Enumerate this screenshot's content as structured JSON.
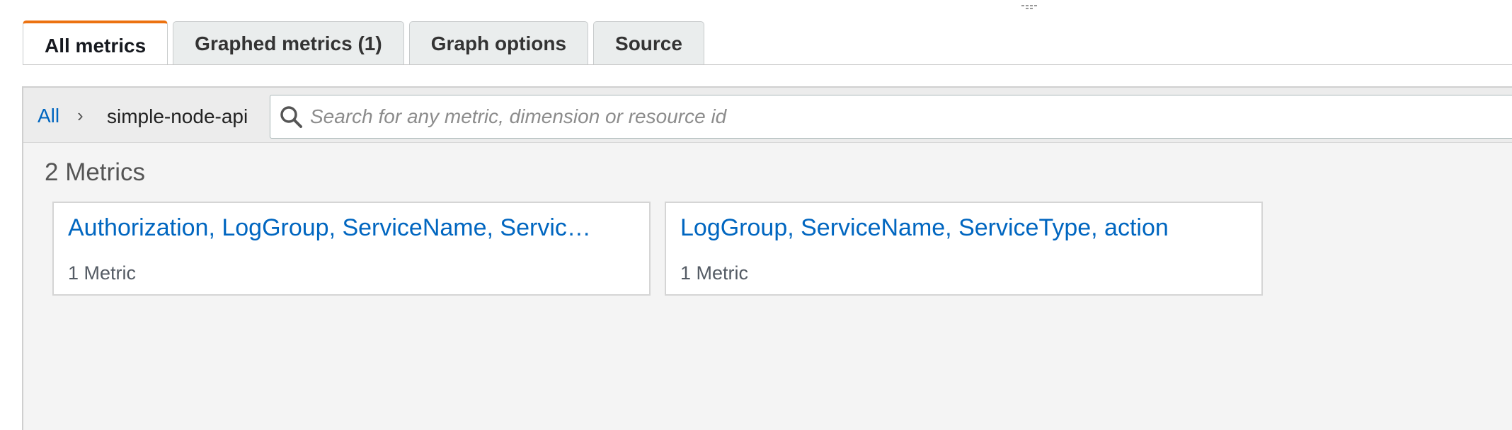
{
  "tabs": [
    {
      "label": "All metrics",
      "active": true
    },
    {
      "label": "Graphed metrics (1)",
      "active": false
    },
    {
      "label": "Graph options",
      "active": false
    },
    {
      "label": "Source",
      "active": false
    }
  ],
  "breadcrumb": {
    "root": "All",
    "separator": "›",
    "current": "simple-node-api"
  },
  "search": {
    "placeholder": "Search for any metric, dimension or resource id",
    "value": ""
  },
  "results": {
    "count_label": "2 Metrics",
    "cards": [
      {
        "title": "Authorization, LogGroup, ServiceName, Servic…",
        "subtitle": "1 Metric"
      },
      {
        "title": "LogGroup, ServiceName, ServiceType, action",
        "subtitle": "1 Metric"
      }
    ]
  },
  "colors": {
    "accent": "#ec7211",
    "link": "#0066c0",
    "panel_bg": "#f4f4f4"
  },
  "icons": {
    "search": "search-icon",
    "grip": "drag-handle-icon",
    "separator": "chevron-right-icon"
  }
}
